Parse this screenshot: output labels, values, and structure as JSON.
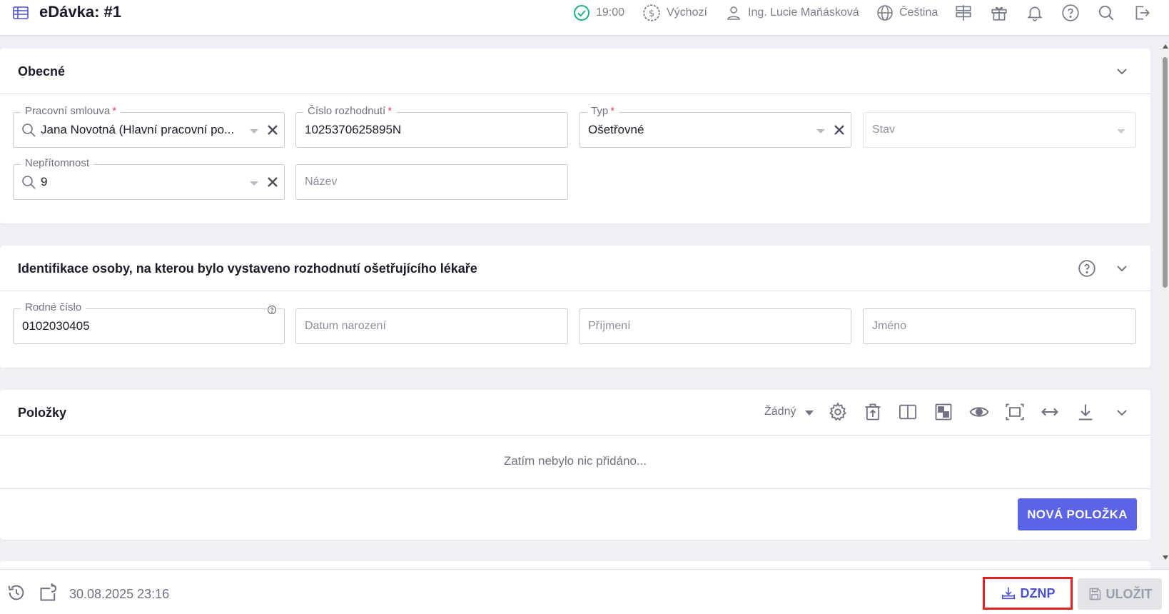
{
  "header": {
    "title": "eDávka: #1",
    "time": "19:00",
    "currency": "Výchozí",
    "user": "Ing. Lucie Maňásková",
    "language": "Čeština"
  },
  "obecne": {
    "title": "Obecné",
    "fields": {
      "pracovni_smlouva": {
        "label": "Pracovní smlouva",
        "value": "Jana Novotná (Hlavní pracovní po..."
      },
      "cislo_rozhodnuti": {
        "label": "Číslo rozhodnutí",
        "value": "1025370625895N"
      },
      "typ": {
        "label": "Typ",
        "value": "Ošetřovné"
      },
      "stav": {
        "placeholder": "Stav"
      },
      "nepritomnost": {
        "label": "Nepřítomnost",
        "value": "9"
      },
      "nazev": {
        "placeholder": "Název"
      }
    }
  },
  "identifikace": {
    "title": "Identifikace osoby, na kterou bylo vystaveno rozhodnutí ošetřujícího lékaře",
    "fields": {
      "rodne_cislo": {
        "label": "Rodné číslo",
        "value": "0102030405"
      },
      "datum_narozeni": {
        "placeholder": "Datum narození"
      },
      "prijmeni": {
        "placeholder": "Příjmení"
      },
      "jmeno": {
        "placeholder": "Jméno"
      }
    }
  },
  "polozky": {
    "title": "Položky",
    "filter": "Žádný",
    "empty_message": "Zatím nebylo nic přidáno...",
    "new_button": "NOVÁ POLOŽKA"
  },
  "footer": {
    "timestamp": "30.08.2025 23:16",
    "dznp_label": "DZNP",
    "save_label": "ULOŽIT"
  },
  "colors": {
    "accent": "#5b63e6",
    "required": "#e53950",
    "success": "#1ab37a",
    "highlight_border": "#e0231f"
  }
}
